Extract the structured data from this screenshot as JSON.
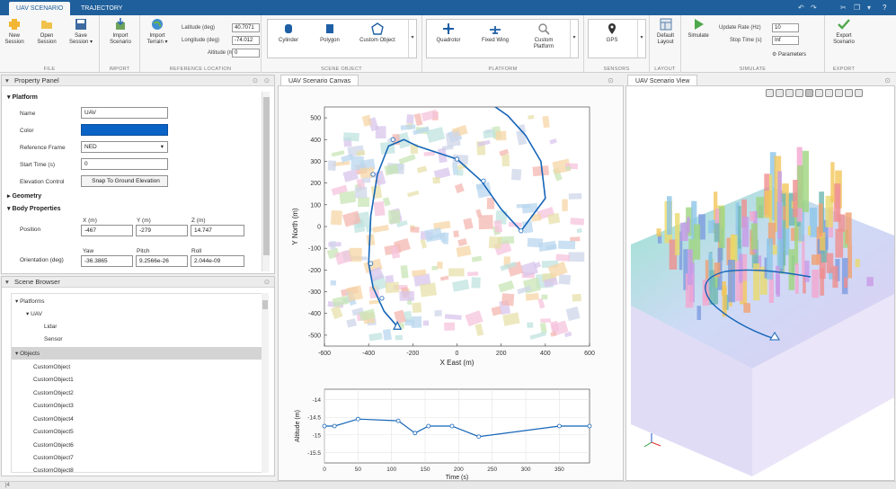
{
  "tabs": [
    "UAV SCENARIO",
    "TRAJECTORY"
  ],
  "ribbon": {
    "file": {
      "label": "FILE",
      "new": "New Session",
      "open": "Open Session",
      "save": "Save Session ▾"
    },
    "import": {
      "label": "IMPORT",
      "scenario": "Import Scenario"
    },
    "refloc": {
      "label": "REFERENCE LOCATION",
      "terrain": "Import Terrain ▾",
      "lat_label": "Latitude (deg)",
      "lat": "40.7071",
      "lon_label": "Longitude (deg)",
      "lon": "-74.012",
      "alt_label": "Altitude (m)",
      "alt": "0"
    },
    "scene": {
      "label": "SCENE OBJECT",
      "items": [
        "Cylinder",
        "Polygon",
        "Custom Object"
      ]
    },
    "platform": {
      "label": "PLATFORM",
      "items": [
        "Quadrotor",
        "Fixed Wing",
        "Custom Platform"
      ]
    },
    "sensors": {
      "label": "SENSORS",
      "gps": "GPS"
    },
    "layout": {
      "label": "LAYOUT",
      "default": "Default Layout"
    },
    "simulate": {
      "label": "SIMULATE",
      "btn": "Simulate",
      "rate_label": "Update Rate (Hz)",
      "rate": "10",
      "stop_label": "Stop Time (s)",
      "stop": "Inf",
      "params": "Parameters"
    },
    "export": {
      "label": "EXPORT",
      "btn": "Export Scenario"
    }
  },
  "property_panel": {
    "title": "Property Panel",
    "platform_section": "Platform",
    "name_label": "Name",
    "name": "UAV",
    "color_label": "Color",
    "color": "#0b63c6",
    "frame_label": "Reference Frame",
    "frame": "NED",
    "start_label": "Start Time (s)",
    "start": "0",
    "elev_label": "Elevation Control",
    "elev": "Snap To Ground Elevation",
    "geometry": "Geometry",
    "body": "Body Properties",
    "pos_label": "Position",
    "pos_headers": [
      "X (m)",
      "Y (m)",
      "Z (m)"
    ],
    "pos": [
      "-467",
      "-279",
      "14.747"
    ],
    "orient_label": "Orientation (deg)",
    "orient_headers": [
      "Yaw",
      "Pitch",
      "Roll"
    ],
    "orient": [
      "-36.3865",
      "9.2566e-26",
      "2.044e-09"
    ]
  },
  "scene_browser": {
    "title": "Scene Browser",
    "items": [
      "Platforms",
      "UAV",
      "Lidar",
      "Sensor",
      "Objects",
      "CustomObject",
      "CustomObject1",
      "CustomObject2",
      "CustomObject3",
      "CustomObject4",
      "CustomObject5",
      "CustomObject6",
      "CustomObject7",
      "CustomObject8"
    ]
  },
  "canvas": {
    "tab": "UAV Scenario Canvas",
    "chart_data": [
      {
        "type": "line",
        "xlabel": "X East (m)",
        "ylabel": "Y North (m)",
        "xlim": [
          -600,
          600
        ],
        "ylim": [
          -550,
          550
        ],
        "xticks": [
          -600,
          -400,
          -200,
          0,
          200,
          400,
          600
        ],
        "yticks": [
          -500,
          -400,
          -300,
          -200,
          -100,
          0,
          100,
          200,
          300,
          400,
          500
        ],
        "x": [
          -270,
          -330,
          -380,
          -400,
          -390,
          -360,
          -310,
          -240,
          -180,
          -90,
          0,
          110,
          200,
          290,
          400,
          380,
          310,
          230,
          160
        ],
        "y": [
          -460,
          -390,
          -280,
          -170,
          50,
          240,
          370,
          400,
          370,
          340,
          310,
          210,
          80,
          -20,
          130,
          300,
          420,
          510,
          560
        ],
        "waypoints_x": [
          -270,
          -340,
          -390,
          -380,
          -290,
          0,
          120,
          290
        ],
        "waypoints_y": [
          -460,
          -330,
          -170,
          240,
          400,
          310,
          210,
          -20
        ]
      },
      {
        "type": "line",
        "xlabel": "Time (s)",
        "ylabel": "Altitude (m)",
        "xlim": [
          0,
          395
        ],
        "ylim": [
          -15.8,
          -13.7
        ],
        "xticks": [
          0,
          50,
          100,
          150,
          200,
          250,
          300,
          350
        ],
        "yticks": [
          -14,
          -14.5,
          -15,
          -15.5
        ],
        "x": [
          0,
          15,
          50,
          110,
          135,
          155,
          190,
          230,
          350,
          395
        ],
        "y": [
          -14.75,
          -14.75,
          -14.55,
          -14.6,
          -14.95,
          -14.75,
          -14.75,
          -15.05,
          -14.75,
          -14.75
        ]
      }
    ]
  },
  "view": {
    "tab": "UAV Scenario View"
  },
  "status": "|4"
}
